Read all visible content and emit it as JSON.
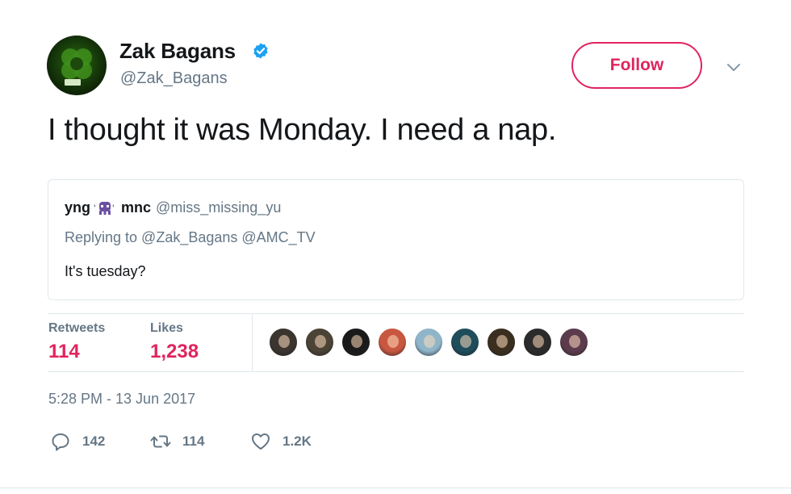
{
  "author": {
    "name": "Zak Bagans",
    "handle": "@Zak_Bagans",
    "verified": true
  },
  "follow_button": {
    "label": "Follow",
    "color": "#e0245e"
  },
  "tweet": {
    "text": "I thought it was Monday. I need a nap.",
    "timestamp": "5:28 PM - 13 Jun 2017"
  },
  "quoted_tweet": {
    "name_part1": "yng",
    "emoji_icon": "alien-monster-icon",
    "name_part2": "mnc",
    "handle": "@miss_missing_yu",
    "replying_to": "Replying to @Zak_Bagans @AMC_TV",
    "text": "It's tuesday?"
  },
  "stats": {
    "retweets_label": "Retweets",
    "retweets_value": "114",
    "likes_label": "Likes",
    "likes_value": "1,238",
    "value_color": "#e0245e"
  },
  "liker_avatars": [
    {
      "icon": "avatar-1",
      "color": "#3b3530"
    },
    {
      "icon": "avatar-2",
      "color": "#4a4336"
    },
    {
      "icon": "avatar-3",
      "color": "#1a1a1a"
    },
    {
      "icon": "avatar-4",
      "color": "#c9573f"
    },
    {
      "icon": "avatar-5",
      "color": "#8fb5c9"
    },
    {
      "icon": "avatar-6",
      "color": "#1e4d5c"
    },
    {
      "icon": "avatar-7",
      "color": "#3a2f1f"
    },
    {
      "icon": "avatar-8",
      "color": "#2b2b2b"
    },
    {
      "icon": "avatar-9",
      "color": "#5c3b4d"
    }
  ],
  "actions": {
    "reply_count": "142",
    "retweet_count": "114",
    "like_count": "1.2K"
  }
}
